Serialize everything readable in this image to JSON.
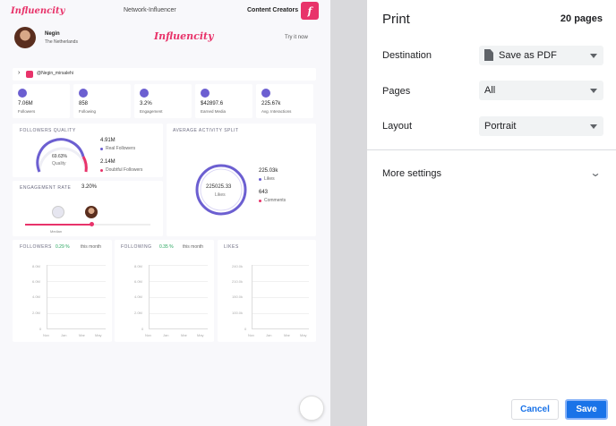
{
  "preview": {
    "brand": "Influencity",
    "nav_center": "Network-Influencer",
    "nav_right": "Content Creators",
    "profile": {
      "name": "Negin",
      "location": "The Netherlands"
    },
    "try_now": "Try it now",
    "handle": "@Negin_mirsalehi",
    "stats": [
      {
        "value": "7.06M",
        "label": "Followers"
      },
      {
        "value": "858",
        "label": "Following"
      },
      {
        "value": "3.2%",
        "label": "Engagement"
      },
      {
        "value": "$42897.6",
        "label": "Earned Media"
      },
      {
        "value": "225.67k",
        "label": "Avg. Interactions"
      }
    ],
    "followers_quality": {
      "title": "FOLLOWERS QUALITY",
      "percent": "69.63%",
      "percent_label": "Quality",
      "real_value": "4.91M",
      "real_label": "Real Followers",
      "doubtful_value": "2.14M",
      "doubtful_label": "Doubtful Followers"
    },
    "engagement": {
      "title": "ENGAGEMENT RATE",
      "value": "3.20%",
      "median_label": "Median"
    },
    "activity": {
      "title": "AVERAGE ACTIVITY SPLIT",
      "center_value": "225025.33",
      "center_label": "Likes",
      "likes_value": "225.03k",
      "likes_label": "Likes",
      "comments_value": "643",
      "comments_label": "Comments"
    },
    "mini_charts": [
      {
        "title": "FOLLOWERS",
        "delta": "0.29 %",
        "suffix": "this month",
        "yticks": [
          "8.0M",
          "6.0M",
          "4.0M",
          "2.0M",
          "0"
        ],
        "xticks": [
          "Nov",
          "Jan",
          "Mar",
          "May"
        ]
      },
      {
        "title": "FOLLOWING",
        "delta": "0.35 %",
        "suffix": "this month",
        "yticks": [
          "8.0M",
          "6.0M",
          "4.0M",
          "2.0M",
          "0"
        ],
        "xticks": [
          "Nov",
          "Jan",
          "Mar",
          "May"
        ]
      },
      {
        "title": "LIKES",
        "delta": "",
        "suffix": "",
        "yticks": [
          "240.0k",
          "210.0k",
          "150.0k",
          "100.0k",
          "0"
        ],
        "xticks": [
          "Nov",
          "Jan",
          "Mar",
          "May"
        ]
      }
    ]
  },
  "print": {
    "title": "Print",
    "pages_count": "20 pages",
    "destination": {
      "label": "Destination",
      "value": "Save as PDF"
    },
    "pages": {
      "label": "Pages",
      "value": "All"
    },
    "layout": {
      "label": "Layout",
      "value": "Portrait"
    },
    "more_settings": "More settings",
    "cancel": "Cancel",
    "save": "Save"
  },
  "colors": {
    "accent": "#1a73e8",
    "brand": "#e8336a",
    "purple": "#6c5fd1"
  }
}
